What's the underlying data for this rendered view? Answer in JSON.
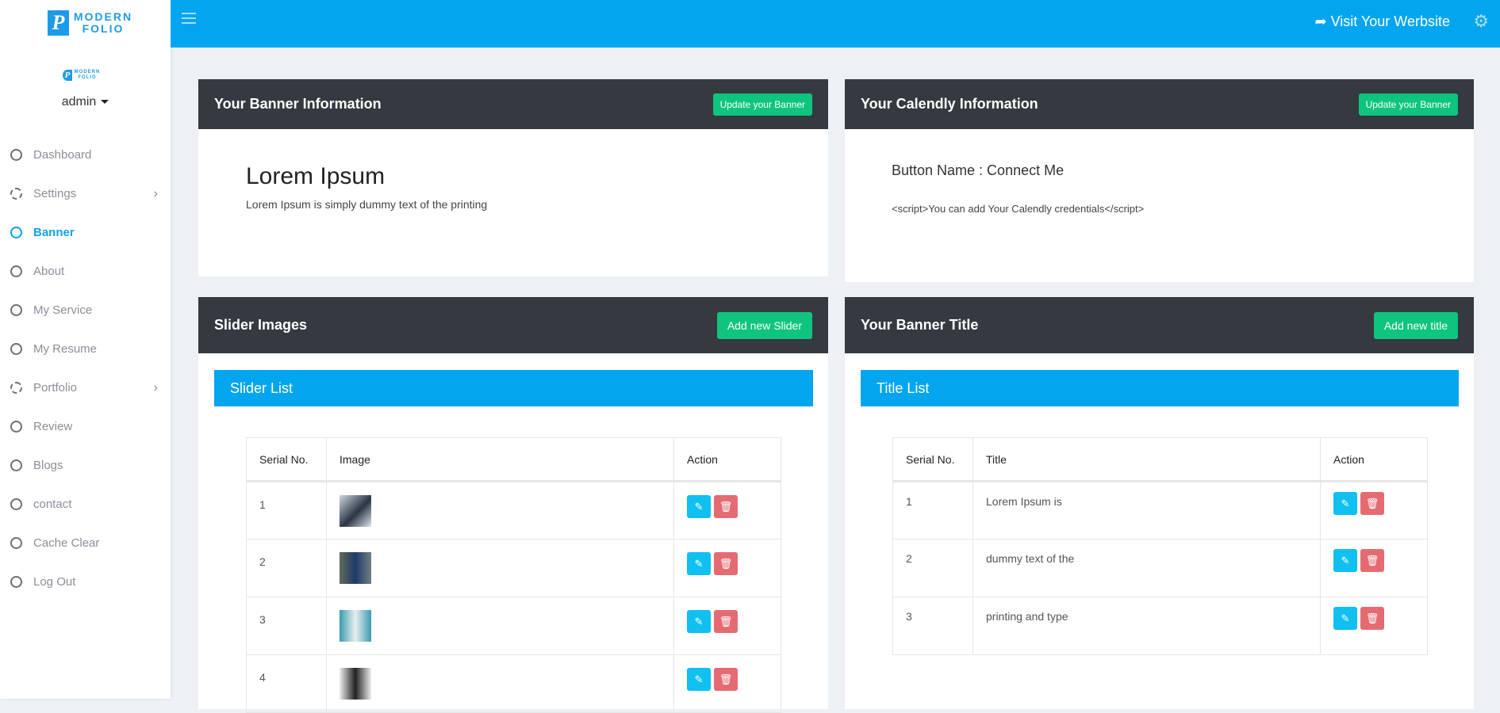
{
  "brand": {
    "logo_letter": "P",
    "logo_text": "MODERN FOLIO"
  },
  "user": {
    "name": "admin"
  },
  "sidebar": {
    "items": [
      {
        "label": "Dashboard",
        "icon": "circle-icon"
      },
      {
        "label": "Settings",
        "icon": "gauge-icon",
        "has_children": true
      },
      {
        "label": "Banner",
        "icon": "circle-icon",
        "active": true
      },
      {
        "label": "About",
        "icon": "circle-icon"
      },
      {
        "label": "My Service",
        "icon": "circle-icon"
      },
      {
        "label": "My Resume",
        "icon": "circle-icon"
      },
      {
        "label": "Portfolio",
        "icon": "gauge-icon",
        "has_children": true
      },
      {
        "label": "Review",
        "icon": "circle-icon"
      },
      {
        "label": "Blogs",
        "icon": "circle-icon"
      },
      {
        "label": "contact",
        "icon": "circle-icon"
      },
      {
        "label": "Cache Clear",
        "icon": "circle-icon"
      },
      {
        "label": "Log Out",
        "icon": "circle-icon"
      }
    ]
  },
  "topbar": {
    "visit": "Visit Your Werbsite"
  },
  "banner_info": {
    "title": "Your Banner Information",
    "button": "Update your Banner",
    "heading": "Lorem Ipsum",
    "text": "Lorem Ipsum is simply dummy text of the printing"
  },
  "calendly": {
    "title": "Your Calendly Information",
    "button": "Update your Banner",
    "button_name": "Button Name : Connect Me",
    "script": "<script>You can add Your Calendly credentials</script>"
  },
  "slider": {
    "title": "Slider Images",
    "button": "Add new Slider",
    "list_title": "Slider List",
    "columns": [
      "Serial No.",
      "Image",
      "Action"
    ],
    "rows": [
      {
        "serial": "1"
      },
      {
        "serial": "2"
      },
      {
        "serial": "3"
      },
      {
        "serial": "4"
      }
    ]
  },
  "titles": {
    "title": "Your Banner Title",
    "button": "Add new title",
    "list_title": "Title List",
    "columns": [
      "Serial No.",
      "Title",
      "Action"
    ],
    "rows": [
      {
        "serial": "1",
        "title": "Lorem Ipsum is"
      },
      {
        "serial": "2",
        "title": "dummy text of the"
      },
      {
        "serial": "3",
        "title": "printing and type"
      }
    ]
  },
  "colors": {
    "accent": "#03a6ee",
    "header_dark": "#343a40",
    "green": "#0fc47e",
    "edit": "#0fc0f0",
    "delete": "#e56b72"
  }
}
